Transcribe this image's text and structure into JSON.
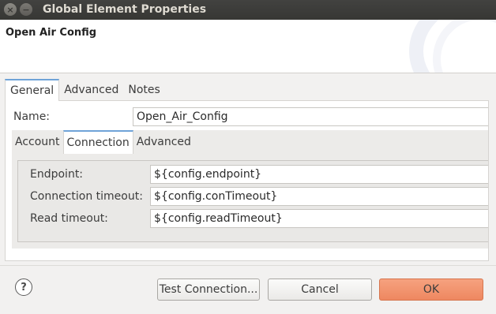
{
  "window": {
    "title": "Global Element Properties",
    "close_glyph": "×",
    "minimize_glyph": "−"
  },
  "header": {
    "title": "Open Air Config"
  },
  "outer_tabs": [
    "General",
    "Advanced",
    "Notes"
  ],
  "outer_active_tab": "General",
  "name": {
    "label": "Name:",
    "value": "Open_Air_Config"
  },
  "inner_tabs": [
    "Account",
    "Connection",
    "Advanced"
  ],
  "inner_active_tab": "Connection",
  "connection": {
    "endpoint_label": "Endpoint:",
    "endpoint_value": "${config.endpoint}",
    "con_timeout_label": "Connection timeout:",
    "con_timeout_value": "${config.conTimeout}",
    "read_timeout_label": "Read timeout:",
    "read_timeout_value": "${config.readTimeout}"
  },
  "footer": {
    "help_glyph": "?",
    "test_connection_label": "Test Connection...",
    "cancel_label": "Cancel",
    "ok_label": "OK"
  },
  "colors": {
    "ok_button": "#ef8b63",
    "active_tab_accent": "#6fa3d8",
    "titlebar": "#3c3b37"
  }
}
